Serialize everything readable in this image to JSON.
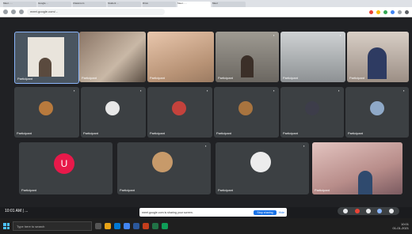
{
  "browser": {
    "tabs": [
      {
        "label": "Meet - ..."
      },
      {
        "label": "Google ..."
      },
      {
        "label": "Classroom"
      },
      {
        "label": "Student ..."
      },
      {
        "label": "Drive"
      },
      {
        "label": "Meet - ..."
      },
      {
        "label": "Meet"
      }
    ],
    "active_tab": 5,
    "url": "meet.google.com/..."
  },
  "tiles_row1": [
    {
      "name": "Participant"
    },
    {
      "name": "Participant"
    },
    {
      "name": "Participant"
    },
    {
      "name": "Participant"
    },
    {
      "name": "Participant"
    },
    {
      "name": "Participant"
    }
  ],
  "tiles_row2": [
    {
      "name": "Participant"
    },
    {
      "name": "Participant"
    },
    {
      "name": "Participant"
    },
    {
      "name": "Participant"
    },
    {
      "name": "Participant"
    },
    {
      "name": "Participant"
    }
  ],
  "tiles_row3": [
    {
      "name": "Participant",
      "initial": "U"
    },
    {
      "name": "Participant"
    },
    {
      "name": "Participant"
    },
    {
      "name": "Participant"
    }
  ],
  "meeting_id": "10:01 AM | ...",
  "banner": {
    "text": "meet.google.com is sharing your screen.",
    "button": "Stop sharing",
    "hide": "Hide"
  },
  "taskbar": {
    "search_placeholder": "Type here to search",
    "time": "10:01",
    "date": "01-01-2021"
  },
  "colors": {
    "accent": "#1a73e8",
    "avatar_u": "#e8194a",
    "end_call": "#ea4335"
  }
}
